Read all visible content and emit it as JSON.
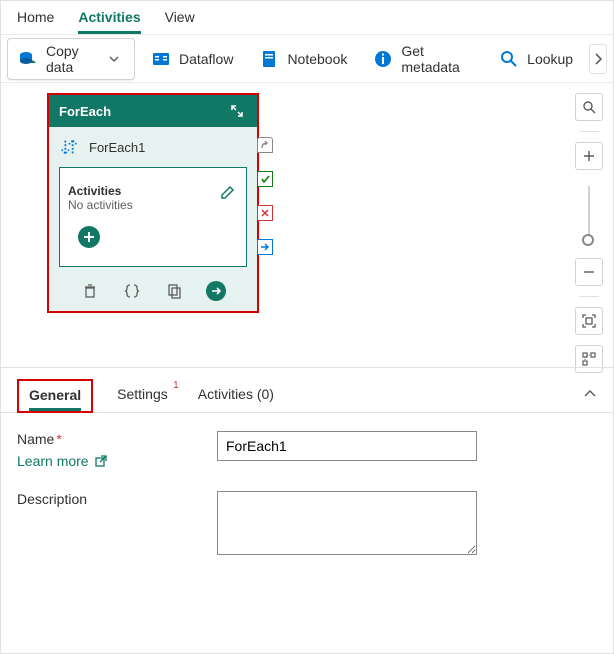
{
  "top_tabs": {
    "home": "Home",
    "activities": "Activities",
    "view": "View"
  },
  "ribbon": {
    "copy_data": "Copy data",
    "dataflow": "Dataflow",
    "notebook": "Notebook",
    "get_metadata": "Get metadata",
    "lookup": "Lookup"
  },
  "foreach": {
    "header": "ForEach",
    "instance_name": "ForEach1",
    "activities_label": "Activities",
    "activities_empty": "No activities"
  },
  "prop_tabs": {
    "general": "General",
    "settings": "Settings",
    "activities": "Activities (0)"
  },
  "properties": {
    "name_label": "Name",
    "learn_more": "Learn more",
    "description_label": "Description",
    "name_value": "ForEach1",
    "description_value": ""
  }
}
